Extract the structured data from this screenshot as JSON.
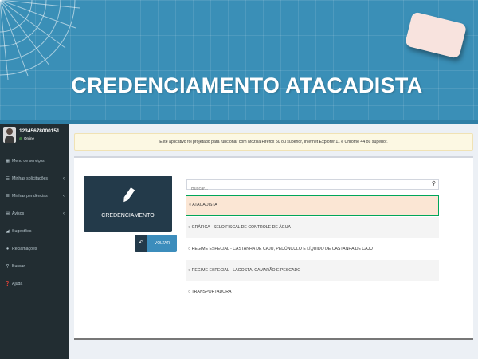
{
  "banner": {
    "title": "CREDENCIAMENTO ATACADISTA"
  },
  "user": {
    "name": "12345678000151",
    "status": "Online"
  },
  "sidebar": {
    "items": [
      {
        "label": "Menu de serviços",
        "icon": "grid-icon",
        "has_chevron": false
      },
      {
        "label": "Minhas solicitações",
        "icon": "list-icon",
        "has_chevron": true
      },
      {
        "label": "Minhas pendências",
        "icon": "list-icon",
        "has_chevron": true
      },
      {
        "label": "Avisos",
        "icon": "calendar-icon",
        "has_chevron": true
      },
      {
        "label": "Sugestões",
        "icon": "bullhorn-icon",
        "has_chevron": false
      },
      {
        "label": "Reclamações",
        "icon": "users-icon",
        "has_chevron": false
      },
      {
        "label": "Buscar",
        "icon": "search-icon",
        "has_chevron": false
      },
      {
        "label": "Ajuda",
        "icon": "help-icon",
        "has_chevron": false
      }
    ]
  },
  "notice": {
    "text": "Este aplicativo foi projetado para funcionar com Mozilla Firefox 50 ou superior, Internet Explorer 11 e Chrome 44 ou superior."
  },
  "panel": {
    "title": "CREDENCIAMENTO",
    "back_label": "VOLTAR"
  },
  "search": {
    "placeholder": "Buscar...",
    "value": ""
  },
  "options": [
    {
      "label": "ATACADISTA",
      "selected": true
    },
    {
      "label": "GRÁFICA - SELO FISCAL DE CONTROLE DE ÁGUA",
      "selected": false
    },
    {
      "label": "REGIME ESPECIAL - CASTANHA DE CAJU, PEDÚNCULO E LÍQUIDO DE CASTANHA DE CAJU",
      "selected": false
    },
    {
      "label": "REGIME ESPECIAL - LAGOSTA, CAMARÃO E PESCADO",
      "selected": false
    },
    {
      "label": "TRANSPORTADORA",
      "selected": false
    }
  ],
  "colors": {
    "banner": "#3a8fb7",
    "sidebar": "#222d32",
    "panel": "#233a4a",
    "accent": "#3c8dbc",
    "selected_border": "#00a65a",
    "selected_bg": "#fbe6d4",
    "notice_bg": "#fcf8e3"
  }
}
